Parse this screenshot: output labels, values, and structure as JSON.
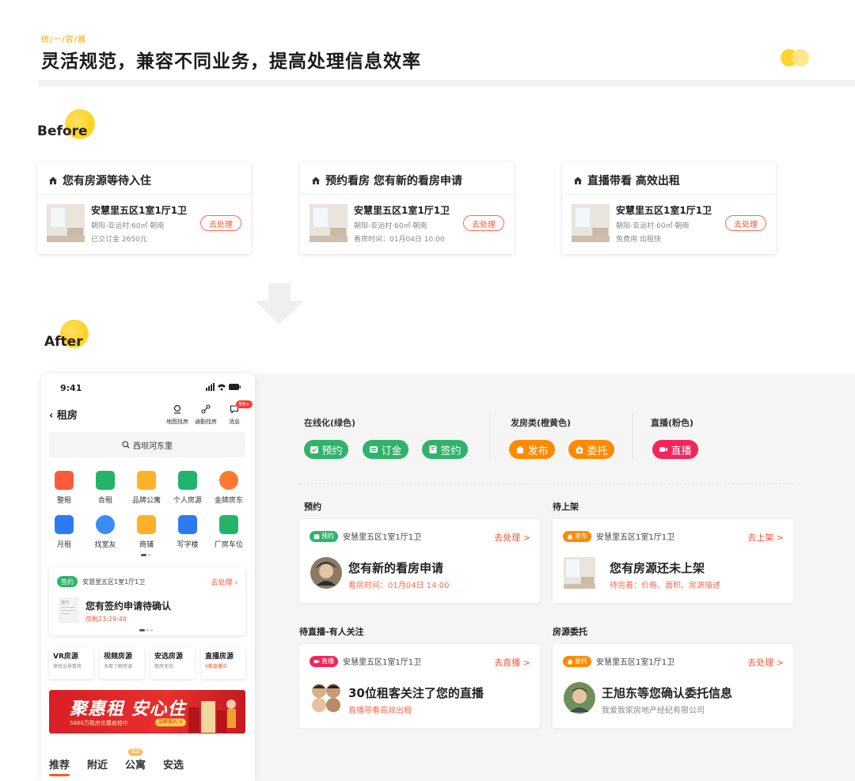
{
  "header": {
    "eyebrow": "统/一/容/器",
    "headline": "灵活规范，兼容不同业务，提高处理信息效率"
  },
  "sections": {
    "before": "Before",
    "after": "After"
  },
  "before_cards": [
    {
      "title": "您有房源等待入住",
      "name": "安慧里五区1室1厅1卫",
      "sub1": "朝阳-亚运村·60㎡·朝南",
      "sub2": "已交订金 2650元",
      "button": "去处理"
    },
    {
      "title": "预约看房 您有新的看房申请",
      "name": "安慧里五区1室1厅1卫",
      "sub1": "朝阳-亚运村·60㎡·朝南",
      "sub2": "看房时间：01月04日 10:00",
      "button": "去处理"
    },
    {
      "title": "直播带看 高效出租",
      "name": "安慧里五区1室1厅1卫",
      "sub1": "朝阳-亚运村·60㎡·朝南",
      "sub2": "免费用 出租快",
      "button": "去处理"
    }
  ],
  "phone": {
    "time": "9:41",
    "back_title": "租房",
    "top_icons": [
      {
        "label": "地图找房",
        "icon": "map-pin-icon"
      },
      {
        "label": "通勤找房",
        "icon": "commute-icon"
      },
      {
        "label": "消息",
        "icon": "message-icon"
      }
    ],
    "message_badge": "99+",
    "search_text": "西坝河东里",
    "grid": [
      {
        "label": "整租",
        "color": "#ff5a3c"
      },
      {
        "label": "合租",
        "color": "#25b36a"
      },
      {
        "label": "品牌公寓",
        "color": "#ffb12a"
      },
      {
        "label": "个人房源",
        "color": "#22b36e"
      },
      {
        "label": "金牌房东",
        "color": "#ff7a2f"
      },
      {
        "label": "月租",
        "color": "#2d7bf4"
      },
      {
        "label": "找室友",
        "color": "#3a8df5"
      },
      {
        "label": "商铺",
        "color": "#ffb12a"
      },
      {
        "label": "写字楼",
        "color": "#2d7bf4"
      },
      {
        "label": "厂房车位",
        "color": "#25b36a"
      }
    ],
    "card": {
      "tag": "签约",
      "address": "安慧里五区1室1厅1卫",
      "action": "去处理",
      "doc_label": "签约",
      "main": "您有签约申请待确认",
      "sub": "仅剩23:29:40"
    },
    "features": [
      {
        "title": "VR房源",
        "sub": "体验全景看房"
      },
      {
        "title": "视频房源",
        "sub": "多面了解房源"
      },
      {
        "title": "安选房源",
        "sub": "租房无忧"
      },
      {
        "title": "直播房源",
        "sub": "9套直播中"
      }
    ],
    "banner": {
      "title": "聚惠租 安心住",
      "sub": "5880万租房优惠疯抢中",
      "pill": "立即加入 >"
    },
    "tabs": [
      "推荐",
      "附近",
      "公寓",
      "安选"
    ],
    "hot_badge": "福袋"
  },
  "panel": {
    "groups": [
      {
        "label": "在线化(绿色)",
        "chips": [
          "预约",
          "订金",
          "签约"
        ]
      },
      {
        "label": "发房类(橙黄色)",
        "chips": [
          "发布",
          "委托"
        ]
      },
      {
        "label": "直播(粉色)",
        "chips": [
          "直播"
        ]
      }
    ],
    "cards": [
      {
        "section": "预约",
        "tag": "预约",
        "address": "安慧里五区1室1厅1卫",
        "action": "去处理 >",
        "main": "您有新的看房申请",
        "sub": "看房时间：01月04日 14:00"
      },
      {
        "section": "待上架",
        "tag": "发布",
        "address": "安慧里五区1室1厅1卫",
        "action": "去上架 >",
        "main": "您有房源还未上架",
        "sub": "待完善：价格、面积、房源描述"
      },
      {
        "section": "待直播-有人关注",
        "tag": "直播",
        "address": "安慧里五区1室1厅1卫",
        "action": "去直播 >",
        "main": "30位租客关注了您的直播",
        "sub": "直播带看高效出租"
      },
      {
        "section": "房源委托",
        "tag": "委托",
        "address": "安慧里五区1室1厅1卫",
        "action": "去处理 >",
        "main": "王旭东等您确认委托信息",
        "sub": "我爱我家房地产经纪有限公司"
      }
    ]
  },
  "colors": {
    "green": "#2fb36b",
    "orange": "#ff8a00",
    "pink": "#f5245a",
    "accent_red": "#ff5233",
    "yellow": "#ffd52b"
  }
}
